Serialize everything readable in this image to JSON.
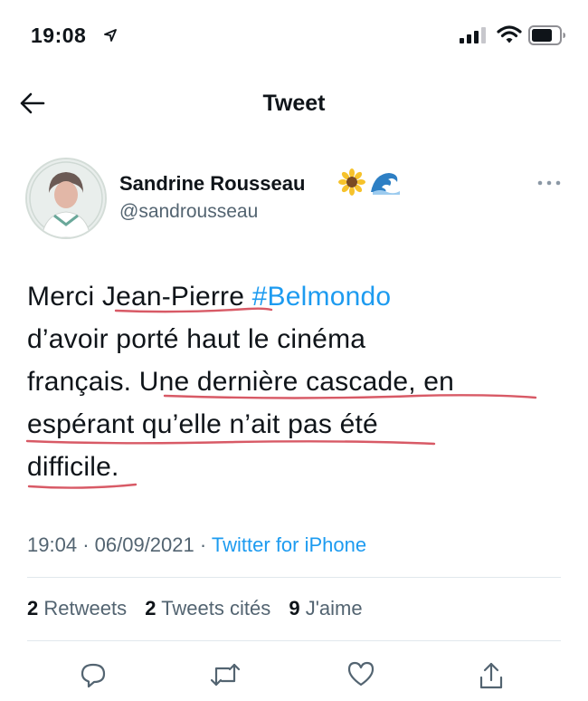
{
  "status_bar": {
    "time": "19:08"
  },
  "nav": {
    "title": "Tweet"
  },
  "author": {
    "name": "Sandrine Rousseau",
    "handle": "@sandrousseau",
    "name_emojis": [
      "sunflower",
      "wave"
    ]
  },
  "tweet": {
    "text_before": "Merci Jean-Pierre ",
    "hashtag": "#Belmondo",
    "text_after": "d’avoir porté haut le cinéma français. Une dernière cascade, en espérant qu’elle n’ait pas été difficile.",
    "lines": [
      "d’avoir porté haut le cinéma",
      "français. Une dernière cascade, en",
      "espérant qu’elle n’ait pas été",
      "difficile."
    ],
    "time": "19:04",
    "date": "06/09/2021",
    "separator": "·",
    "source": "Twitter for iPhone"
  },
  "stats": {
    "retweets_count": "2",
    "retweets_label": "Retweets",
    "quotes_count": "2",
    "quotes_label": "Tweets cités",
    "likes_count": "9",
    "likes_label": "J'aime"
  },
  "icons": {
    "back": "arrow-left-icon",
    "more": "more-horizontal-icon",
    "reply": "reply-icon",
    "retweet": "retweet-icon",
    "like": "heart-icon",
    "share": "share-icon"
  },
  "colors": {
    "accent": "#1d9bf0",
    "underline": "#d85a66",
    "secondary": "#536471"
  }
}
